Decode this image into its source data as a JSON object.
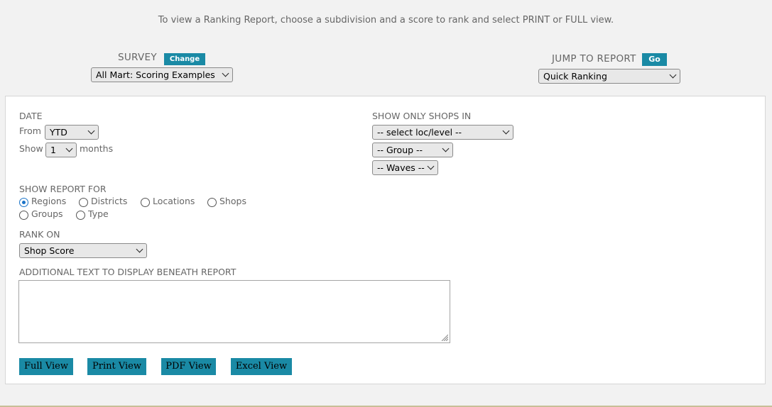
{
  "intro_text": "To view a Ranking Report, choose a subdivision and a score to rank and select PRINT or FULL view.",
  "survey": {
    "label": "SURVEY",
    "change_label": "Change",
    "selected": "All Mart: Scoring Examples"
  },
  "jump": {
    "label": "JUMP TO REPORT",
    "go_label": "Go",
    "selected": "Quick Ranking"
  },
  "date": {
    "heading": "DATE",
    "from_label": "From",
    "from_value": "YTD",
    "show_label": "Show",
    "show_value": "1",
    "months_label": "months"
  },
  "filters": {
    "heading": "SHOW ONLY SHOPS IN",
    "loc_level": "-- select loc/level --",
    "group": "-- Group --",
    "waves": "-- Waves --"
  },
  "report_for": {
    "heading": "SHOW REPORT FOR",
    "options": [
      "Regions",
      "Districts",
      "Locations",
      "Shops",
      "Groups",
      "Type"
    ],
    "selected": "Regions"
  },
  "rank_on": {
    "heading": "RANK ON",
    "selected": "Shop Score"
  },
  "additional_text": {
    "heading": "ADDITIONAL TEXT TO DISPLAY BENEATH REPORT",
    "value": ""
  },
  "actions": {
    "full_view": "Full View",
    "print_view": "Print View",
    "pdf_view": "PDF View",
    "excel_view": "Excel View"
  },
  "colors": {
    "accent": "#1a8aa5",
    "radio_selected": "#1a73c8",
    "background": "#f2f2f2",
    "bottom_rule": "#c8bf97"
  }
}
